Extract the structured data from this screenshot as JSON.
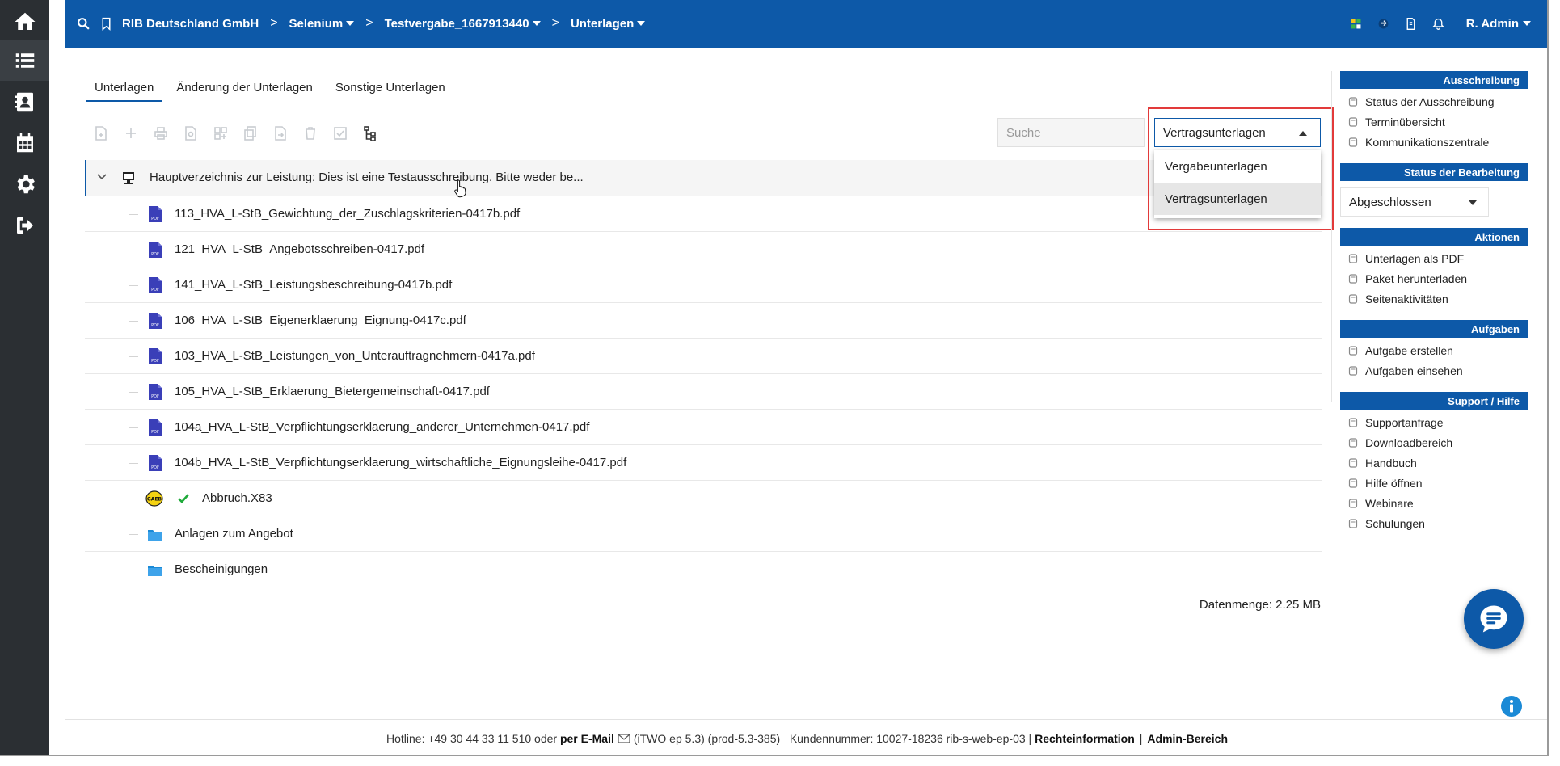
{
  "header": {
    "breadcrumbs": [
      {
        "label": "RIB Deutschland GmbH",
        "dropdown": false
      },
      {
        "label": "Selenium",
        "dropdown": true
      },
      {
        "label": "Testvergabe_1667913440",
        "dropdown": true
      },
      {
        "label": "Unterlagen",
        "dropdown": true
      }
    ],
    "separator": ">",
    "user": "R. Admin"
  },
  "rail": {
    "items": [
      "home-icon",
      "list-icon",
      "contacts-icon",
      "calendar-icon",
      "gear-icon",
      "logout-icon"
    ]
  },
  "tabs": [
    "Unterlagen",
    "Änderung der Unterlagen",
    "Sonstige Unterlagen"
  ],
  "search": {
    "placeholder": "Suche",
    "value": ""
  },
  "doc_select": {
    "value": "Vertragsunterlagen",
    "options": [
      "Vergabeunterlagen",
      "Vertragsunterlagen"
    ]
  },
  "tree": {
    "root": "Hauptverzeichnis zur Leistung: Dies ist eine Testausschreibung. Bitte weder be...",
    "items": [
      {
        "label": "113_HVA_L-StB_Gewichtung_der_Zuschlagskriterien-0417b.pdf",
        "type": "pdf"
      },
      {
        "label": "121_HVA_L-StB_Angebotsschreiben-0417.pdf",
        "type": "pdf"
      },
      {
        "label": "141_HVA_L-StB_Leistungsbeschreibung-0417b.pdf",
        "type": "pdf"
      },
      {
        "label": "106_HVA_L-StB_Eigenerklaerung_Eignung-0417c.pdf",
        "type": "pdf"
      },
      {
        "label": "103_HVA_L-StB_Leistungen_von_Unterauftragnehmern-0417a.pdf",
        "type": "pdf"
      },
      {
        "label": "105_HVA_L-StB_Erklaerung_Bietergemeinschaft-0417.pdf",
        "type": "pdf"
      },
      {
        "label": "104a_HVA_L-StB_Verpflichtungserklaerung_anderer_Unternehmen-0417.pdf",
        "type": "pdf"
      },
      {
        "label": "104b_HVA_L-StB_Verpflichtungserklaerung_wirtschaftliche_Eignungsleihe-0417.pdf",
        "type": "pdf"
      },
      {
        "label": "Abbruch.X83",
        "type": "x83"
      },
      {
        "label": "Anlagen zum Angebot",
        "type": "folder"
      },
      {
        "label": "Bescheinigungen",
        "type": "folder"
      }
    ],
    "pdf_tag": "PDF",
    "x83_tag": "GAEB"
  },
  "datasize": "Datenmenge: 2.25 MB",
  "side_panel": {
    "ausschreibung": {
      "title": "Ausschreibung",
      "links": [
        "Status der Ausschreibung",
        "Terminübersicht",
        "Kommunikationszentrale"
      ]
    },
    "status": {
      "title": "Status der Bearbeitung",
      "value": "Abgeschlossen"
    },
    "aktionen": {
      "title": "Aktionen",
      "links": [
        "Unterlagen als PDF",
        "Paket herunterladen",
        "Seitenaktivitäten"
      ]
    },
    "aufgaben": {
      "title": "Aufgaben",
      "links": [
        "Aufgabe erstellen",
        "Aufgaben einsehen"
      ]
    },
    "support": {
      "title": "Support / Hilfe",
      "links": [
        "Supportanfrage",
        "Downloadbereich",
        "Handbuch",
        "Hilfe öffnen",
        "Webinare",
        "Schulungen"
      ]
    }
  },
  "footer": {
    "hotline": "Hotline: +49 30 44 33 11 510 oder",
    "email": "per E-Mail",
    "version": "(iTWO ep 5.3) (prod-5.3-385)",
    "customer": "Kundennummer: 10027-18236 rib-s-web-ep-03 |",
    "legal": "Rechteinformation",
    "divider": "|",
    "admin": "Admin-Bereich"
  },
  "colors": {
    "primary": "#0d59a8",
    "rail": "#2b2f33",
    "highlight": "#e23a3a",
    "pdf": "#3a3fb8",
    "folder": "#1b8ad6",
    "check": "#1faa3a"
  }
}
